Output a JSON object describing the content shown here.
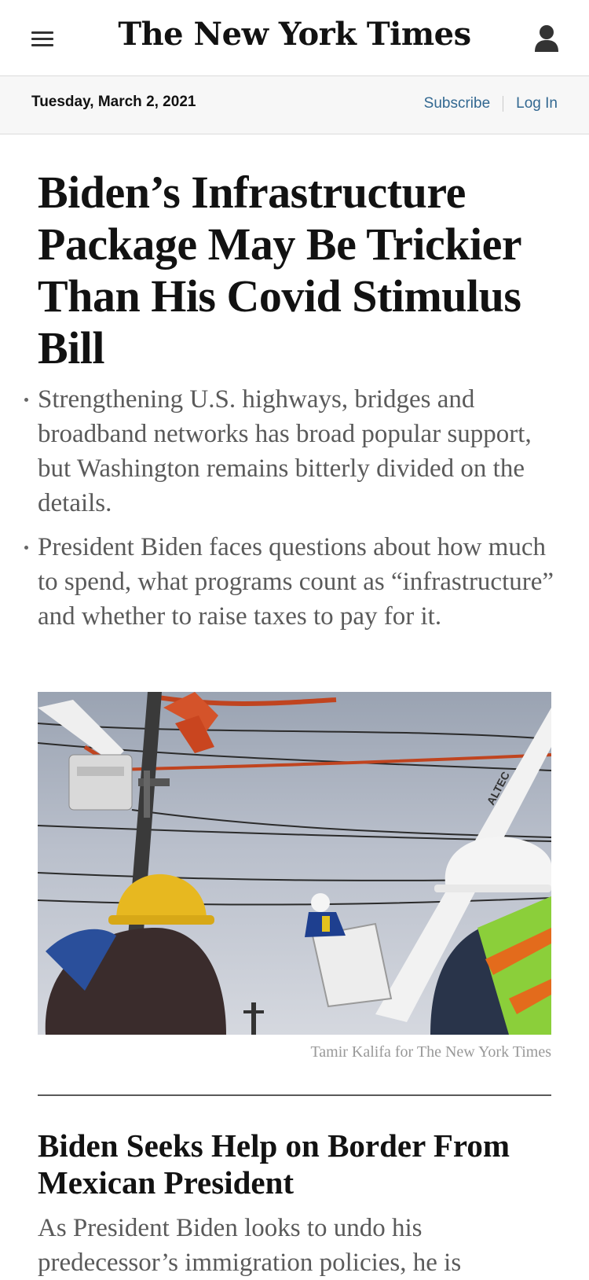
{
  "header": {
    "logo_text": "The New York Times",
    "menu_icon": "hamburger-menu-icon",
    "account_icon": "user-icon"
  },
  "datebar": {
    "date": "Tuesday, March 2, 2021",
    "subscribe_label": "Subscribe",
    "login_label": "Log In"
  },
  "lead_story": {
    "headline": "Biden’s Infrastructure Package May Be Trickier Than His Covid Stimulus Bill",
    "bullets": [
      "Strengthening U.S. highways, bridges and broadband networks has broad popular support, but Washington remains bitterly divided on the details.",
      "President Biden faces questions about how much to spend, what programs count as “infrastructure” and whether to raise taxes to pay for it."
    ],
    "image_credit": "Tamir Kalifa for The New York Times",
    "image_logo_text": "ALTEC"
  },
  "second_story": {
    "headline": "Biden Seeks Help on Border From Mexican President",
    "summary": "As President Biden looks to undo his predecessor’s immigration policies, he is"
  },
  "colors": {
    "link": "#326891",
    "headline": "#121212",
    "summary": "#5a5a5a",
    "credit": "#999999"
  }
}
